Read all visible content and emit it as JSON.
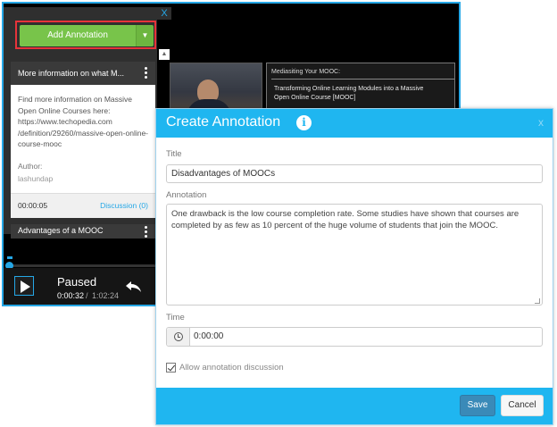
{
  "player": {
    "panel": {
      "close_glyph": "X",
      "add_button_label": "Add Annotation",
      "caret_glyph": "▼",
      "scroll_up_glyph": "▲",
      "cards": [
        {
          "title": "More information on what M...",
          "body": "Find more information on Massive Open Online Courses here: https://www.techopedia.com /definition/29260/massive-open-online-course-mooc",
          "author_label": "Author:",
          "author": "lashundap",
          "time": "00:00:05",
          "discussion": "Discussion (0)"
        },
        {
          "title": "Advantages of a MOOC"
        }
      ]
    },
    "slide": {
      "title": "Mediasiting Your MOOC:",
      "body": "Transforming Online Learning Modules into a Massive Open Online Course [MOOC]"
    },
    "controls": {
      "state": "Paused",
      "current_time": "0:00:32",
      "separator": "/",
      "total_time": "1:02:24"
    }
  },
  "modal": {
    "title": "Create Annotation",
    "info_glyph": "i",
    "close_glyph": "x",
    "title_label": "Title",
    "title_value": "Disadvantages of MOOCs",
    "annotation_label": "Annotation",
    "annotation_value": "One drawback is the low course completion rate. Some studies have shown that courses are completed by as few as 10 percent of the huge volume of students that join the MOOC.",
    "time_label": "Time",
    "time_value": "0:00:00",
    "allow_discussion_label": "Allow annotation discussion",
    "allow_discussion_checked": true,
    "save_label": "Save",
    "cancel_label": "Cancel"
  },
  "colors": {
    "accent": "#1fb6f0",
    "player_border": "#25a7e6",
    "add_button": "#78c44a",
    "highlight": "#e6343a",
    "save_button": "#3a8ab8"
  },
  "icons": {
    "panel_close": "close-icon",
    "add_caret": "chevron-down-icon",
    "kebab": "more-vertical-icon",
    "play": "play-icon",
    "rewind": "rewind-icon",
    "info": "info-icon",
    "clock": "clock-icon",
    "checkbox": "checkmark-icon"
  }
}
